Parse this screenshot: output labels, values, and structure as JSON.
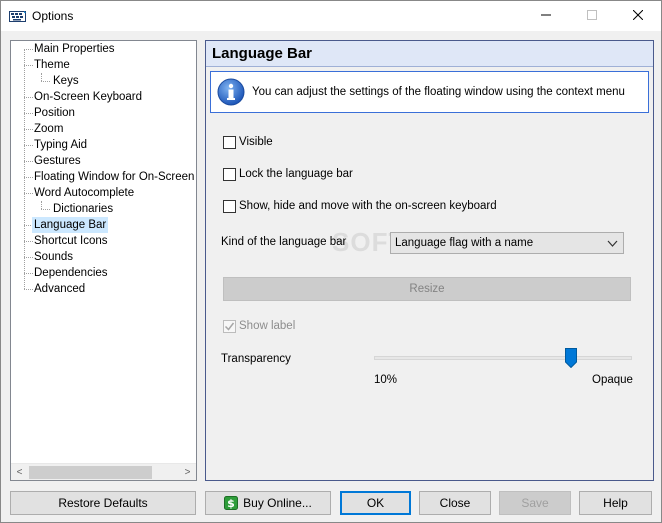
{
  "window": {
    "title": "Options"
  },
  "tree": {
    "items": [
      {
        "label": "Main Properties",
        "level": 0
      },
      {
        "label": "Theme",
        "level": 0
      },
      {
        "label": "Keys",
        "level": 1
      },
      {
        "label": "On-Screen Keyboard",
        "level": 0
      },
      {
        "label": "Position",
        "level": 0
      },
      {
        "label": "Zoom",
        "level": 0
      },
      {
        "label": "Typing Aid",
        "level": 0
      },
      {
        "label": "Gestures",
        "level": 0
      },
      {
        "label": "Floating Window for On-Screen Ke",
        "level": 0
      },
      {
        "label": "Word Autocomplete",
        "level": 0
      },
      {
        "label": "Dictionaries",
        "level": 1
      },
      {
        "label": "Language Bar",
        "level": 0,
        "selected": true
      },
      {
        "label": "Shortcut Icons",
        "level": 0
      },
      {
        "label": "Sounds",
        "level": 0
      },
      {
        "label": "Dependencies",
        "level": 0
      },
      {
        "label": "Advanced",
        "level": 0
      }
    ],
    "scroll_left": "<",
    "scroll_right": ">"
  },
  "panel": {
    "title": "Language Bar",
    "info_text": "You can adjust the settings of the floating window using the context menu",
    "checkboxes": {
      "visible": {
        "label": "Visible",
        "checked": false
      },
      "lock": {
        "label": "Lock the language bar",
        "checked": false
      },
      "show_hide": {
        "label": "Show, hide and move with the on-screen keyboard",
        "checked": false
      },
      "show_label": {
        "label": "Show label",
        "checked": true,
        "disabled": true
      }
    },
    "kind_label": "Kind of the language bar",
    "kind_value": "Language flag with a name",
    "resize_label": "Resize",
    "transparency_label": "Transparency",
    "transparency_min": "10%",
    "transparency_max": "Opaque",
    "transparency_level": 0.76,
    "watermark": "SOFTPEDIA"
  },
  "buttons": {
    "restore": "Restore Defaults",
    "buy": "Buy Online...",
    "ok": "OK",
    "close": "Close",
    "save": "Save",
    "help": "Help"
  },
  "colors": {
    "selection": "#cce8ff",
    "panel_header": "#dfe7f7",
    "accent": "#0078d7",
    "buy_icon": "#2e9d3a"
  }
}
